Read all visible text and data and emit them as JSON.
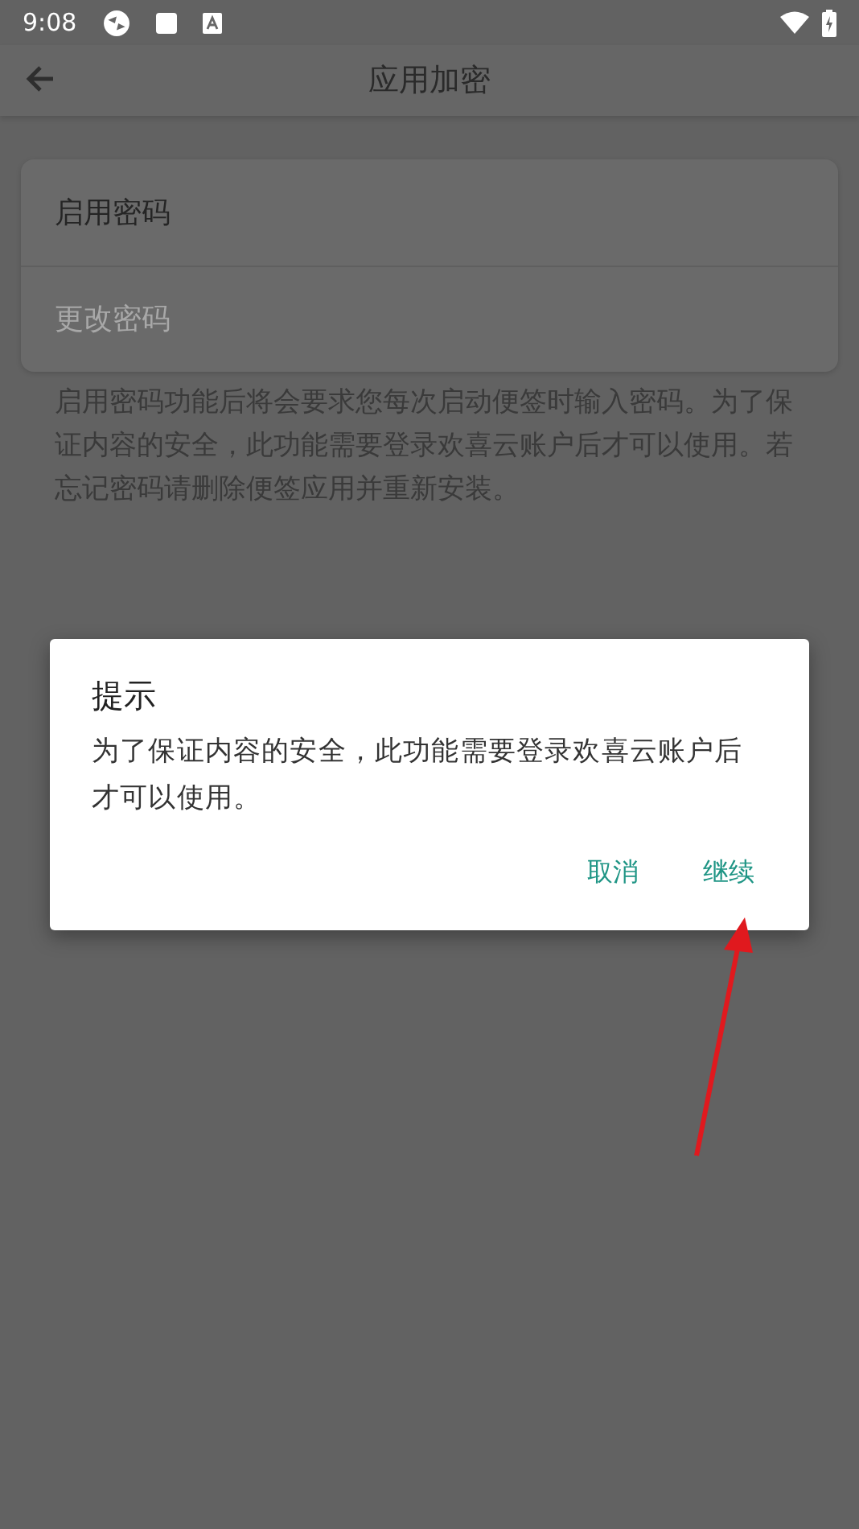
{
  "status_bar": {
    "time": "9:08"
  },
  "app_bar": {
    "title": "应用加密"
  },
  "settings": [
    {
      "label": "启用密码",
      "disabled": false
    },
    {
      "label": "更改密码",
      "disabled": true
    }
  ],
  "description": "启用密码功能后将会要求您每次启动便签时输入密码。为了保证内容的安全，此功能需要登录欢喜云账户后才可以使用。若忘记密码请删除便签应用并重新安装。",
  "dialog": {
    "title": "提示",
    "message": "为了保证内容的安全，此功能需要登录欢喜云账户后才可以使用。",
    "buttons": [
      "取消",
      "继续"
    ]
  }
}
